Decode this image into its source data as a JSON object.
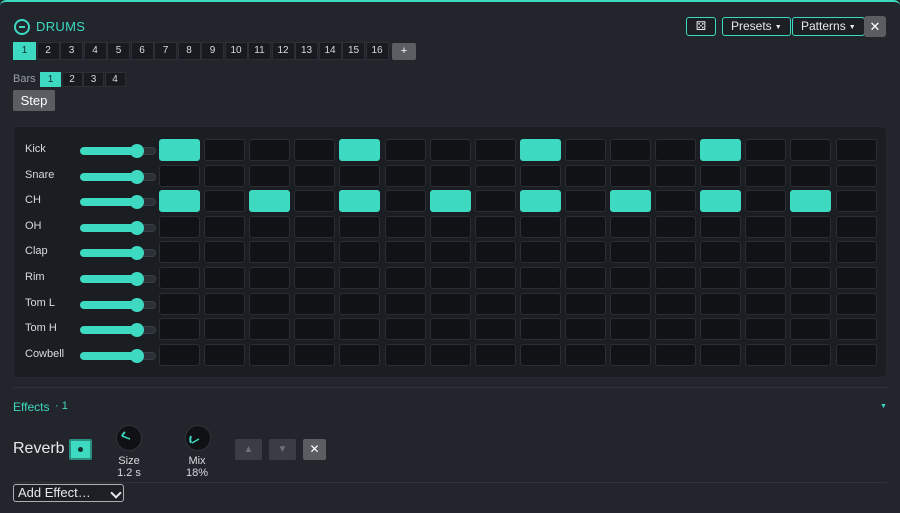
{
  "header": {
    "title": "DRUMS",
    "dice_label": "⚄",
    "presets_label": "Presets",
    "patterns_label": "Patterns",
    "close_label": "✕"
  },
  "patterns": {
    "tabs": [
      "1",
      "2",
      "3",
      "4",
      "5",
      "6",
      "7",
      "8",
      "9",
      "10",
      "11",
      "12",
      "13",
      "14",
      "15",
      "16"
    ],
    "active": 0,
    "add_label": "+"
  },
  "bars": {
    "label": "Bars",
    "tabs": [
      "1",
      "2",
      "3",
      "4"
    ],
    "active": 0
  },
  "step_button": "Step",
  "sequencer": {
    "tracks": [
      {
        "name": "Kick",
        "volume": 0.75,
        "steps": [
          1,
          0,
          0,
          0,
          1,
          0,
          0,
          0,
          1,
          0,
          0,
          0,
          1,
          0,
          0,
          0
        ]
      },
      {
        "name": "Snare",
        "volume": 0.75,
        "steps": [
          0,
          0,
          0,
          0,
          0,
          0,
          0,
          0,
          0,
          0,
          0,
          0,
          0,
          0,
          0,
          0
        ]
      },
      {
        "name": "CH",
        "volume": 0.75,
        "steps": [
          1,
          0,
          1,
          0,
          1,
          0,
          1,
          0,
          1,
          0,
          1,
          0,
          1,
          0,
          1,
          0
        ]
      },
      {
        "name": "OH",
        "volume": 0.75,
        "steps": [
          0,
          0,
          0,
          0,
          0,
          0,
          0,
          0,
          0,
          0,
          0,
          0,
          0,
          0,
          0,
          0
        ]
      },
      {
        "name": "Clap",
        "volume": 0.75,
        "steps": [
          0,
          0,
          0,
          0,
          0,
          0,
          0,
          0,
          0,
          0,
          0,
          0,
          0,
          0,
          0,
          0
        ]
      },
      {
        "name": "Rim",
        "volume": 0.75,
        "steps": [
          0,
          0,
          0,
          0,
          0,
          0,
          0,
          0,
          0,
          0,
          0,
          0,
          0,
          0,
          0,
          0
        ]
      },
      {
        "name": "Tom L",
        "volume": 0.75,
        "steps": [
          0,
          0,
          0,
          0,
          0,
          0,
          0,
          0,
          0,
          0,
          0,
          0,
          0,
          0,
          0,
          0
        ]
      },
      {
        "name": "Tom H",
        "volume": 0.75,
        "steps": [
          0,
          0,
          0,
          0,
          0,
          0,
          0,
          0,
          0,
          0,
          0,
          0,
          0,
          0,
          0,
          0
        ]
      },
      {
        "name": "Cowbell",
        "volume": 0.75,
        "steps": [
          0,
          0,
          0,
          0,
          0,
          0,
          0,
          0,
          0,
          0,
          0,
          0,
          0,
          0,
          0,
          0
        ]
      }
    ]
  },
  "effects": {
    "label": "Effects",
    "count": "· 1",
    "items": [
      {
        "name": "Reverb",
        "enabled": true,
        "params": [
          {
            "label": "Size",
            "value": "1.2 s"
          },
          {
            "label": "Mix",
            "value": "18%"
          }
        ],
        "up_label": "▲",
        "down_label": "▼",
        "remove_label": "✕"
      }
    ],
    "add_effect_label": "Add Effect…"
  },
  "colors": {
    "accent": "#3dd9c1",
    "step_off": "#101215",
    "panel_bg": "#22262c"
  }
}
